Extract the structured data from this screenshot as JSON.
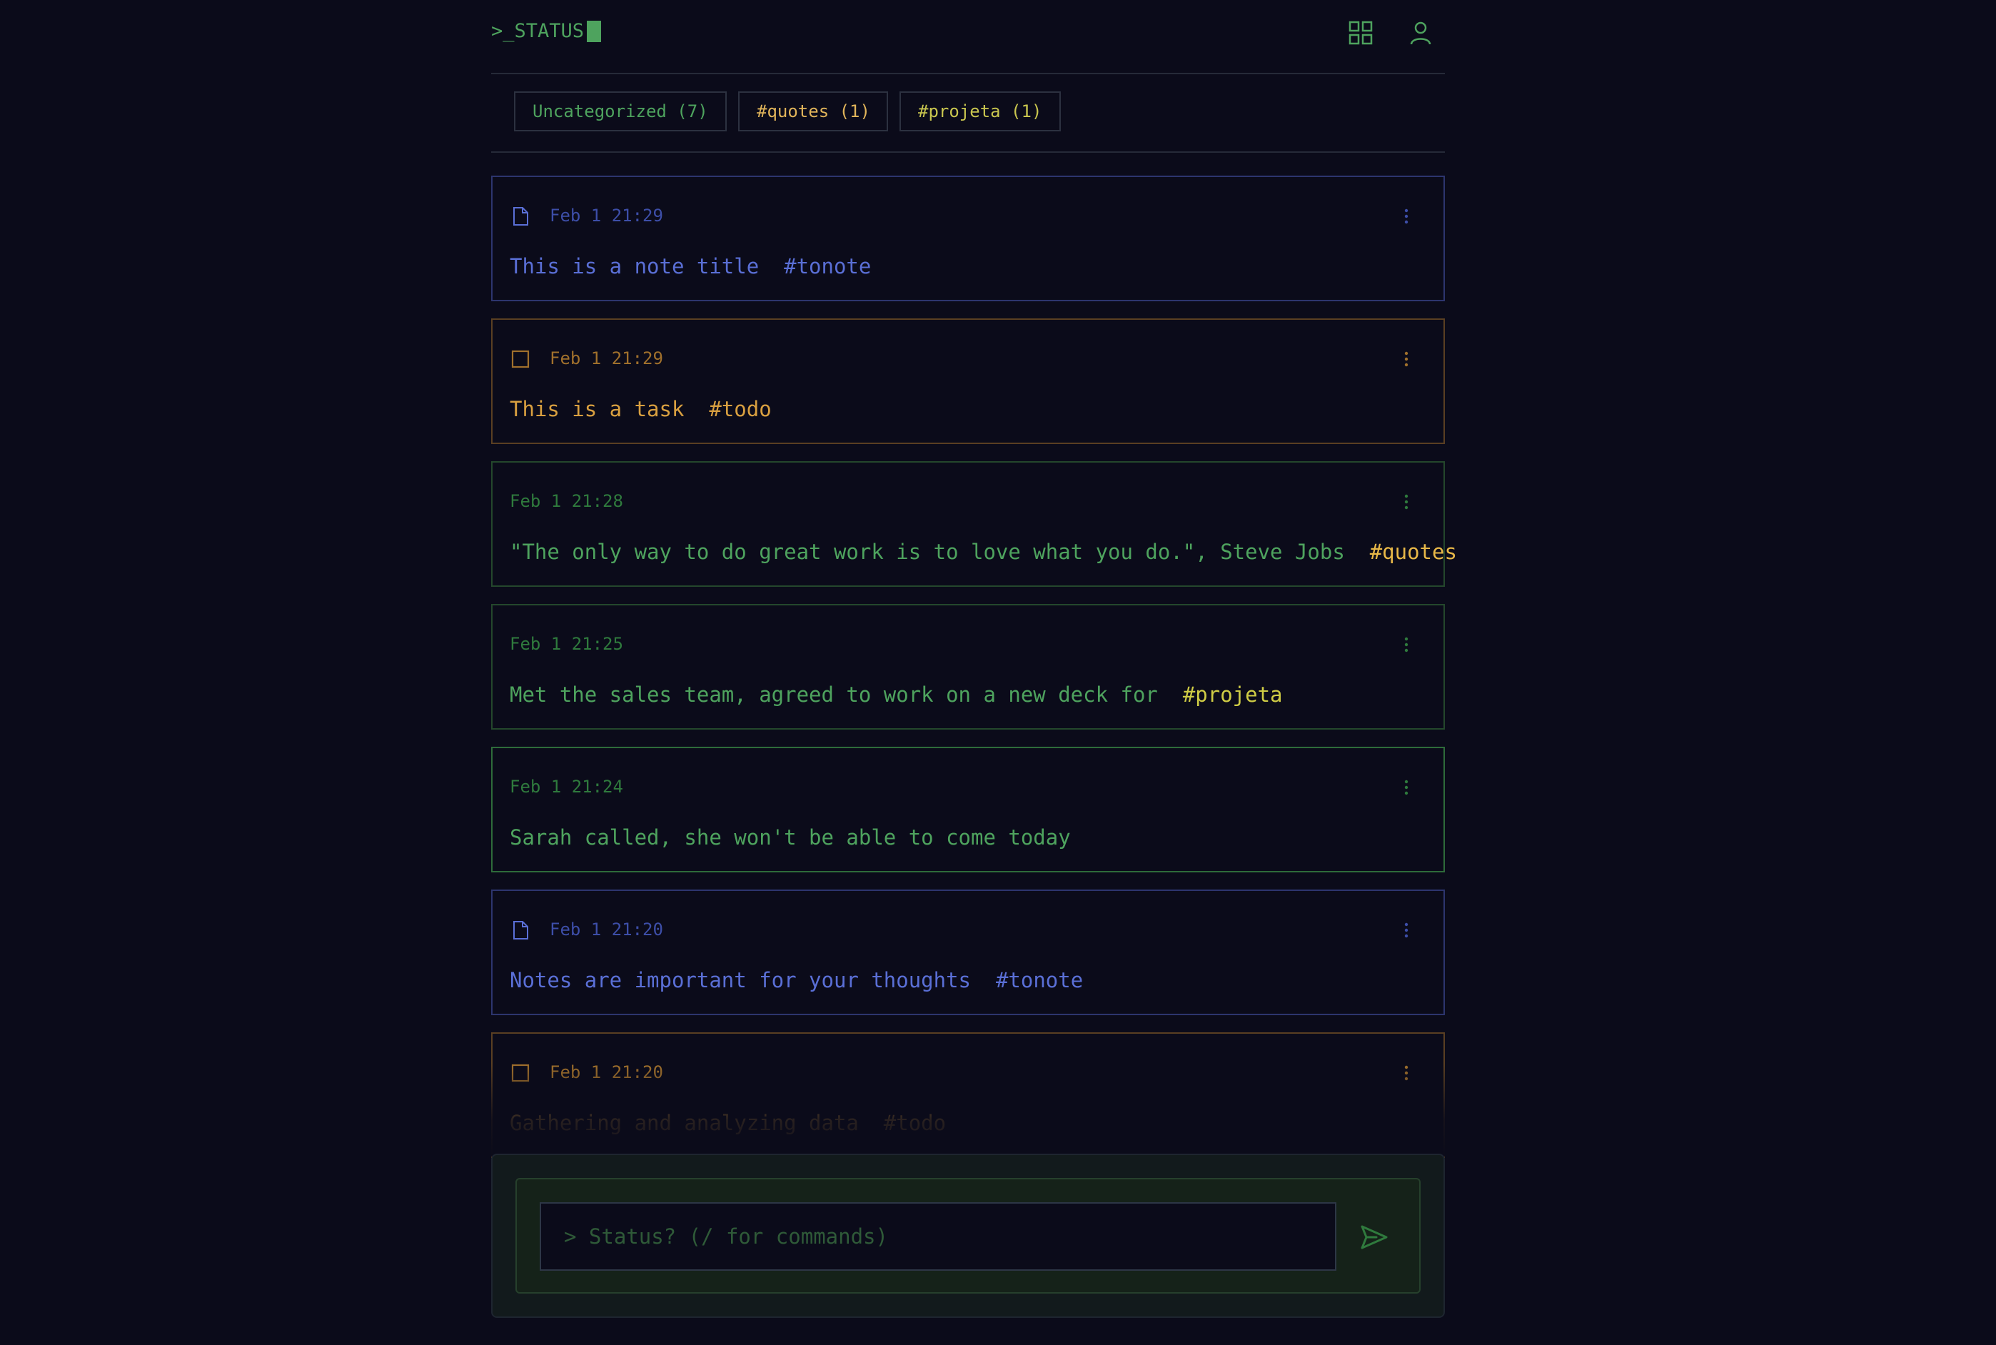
{
  "header": {
    "logo_text": ">_STATUS",
    "grid_icon": "grid-icon",
    "user_icon": "user-icon"
  },
  "filters": [
    {
      "label": "Uncategorized (7)",
      "color": "#4ea35e"
    },
    {
      "label": "#quotes (1)",
      "color": "#e0b45a"
    },
    {
      "label": "#projeta (1)",
      "color": "#c9c64f"
    }
  ],
  "entries": [
    {
      "type": "note",
      "timestamp": "Feb 1 21:29",
      "text": "This is a note title",
      "tag": "#tonote",
      "color": "#5a6fd6",
      "tag_color": "#5a6fd6",
      "border": "#2d356e"
    },
    {
      "type": "task",
      "timestamp": "Feb 1 21:29",
      "text": "This is a task",
      "tag": "#todo",
      "color": "#d9a040",
      "tag_color": "#d9a040",
      "border": "#5a3f22"
    },
    {
      "type": "status",
      "timestamp": "Feb 1 21:28",
      "text": "\"The only way to do great work is to love what you do.\", Steve Jobs",
      "tag": "#quotes",
      "color": "#4ea35e",
      "tag_color": "#e8b848",
      "border": "#24472c"
    },
    {
      "type": "status",
      "timestamp": "Feb 1 21:25",
      "text": "Met the sales team, agreed to work on a new deck for",
      "tag": "#projeta",
      "color": "#4ea35e",
      "tag_color": "#cfcc45",
      "border": "#24472c"
    },
    {
      "type": "status",
      "timestamp": "Feb 1 21:24",
      "text": "Sarah called, she won't be able to come today",
      "tag": "",
      "color": "#4ea35e",
      "tag_color": "#4ea35e",
      "border": "#2e6b3a"
    },
    {
      "type": "note",
      "timestamp": "Feb 1 21:20",
      "text": "Notes are important for your thoughts",
      "tag": "#tonote",
      "color": "#5a6fd6",
      "tag_color": "#5a6fd6",
      "border": "#2d356e"
    },
    {
      "type": "task",
      "timestamp": "Feb 1 21:20",
      "text": "Gathering and analyzing data",
      "tag": "#todo",
      "color": "#d9a040",
      "tag_color": "#d9a040",
      "border": "#5a3f22"
    }
  ],
  "composer": {
    "placeholder": "> Status? (/ for commands)",
    "value": "",
    "send_icon": "send-icon"
  }
}
